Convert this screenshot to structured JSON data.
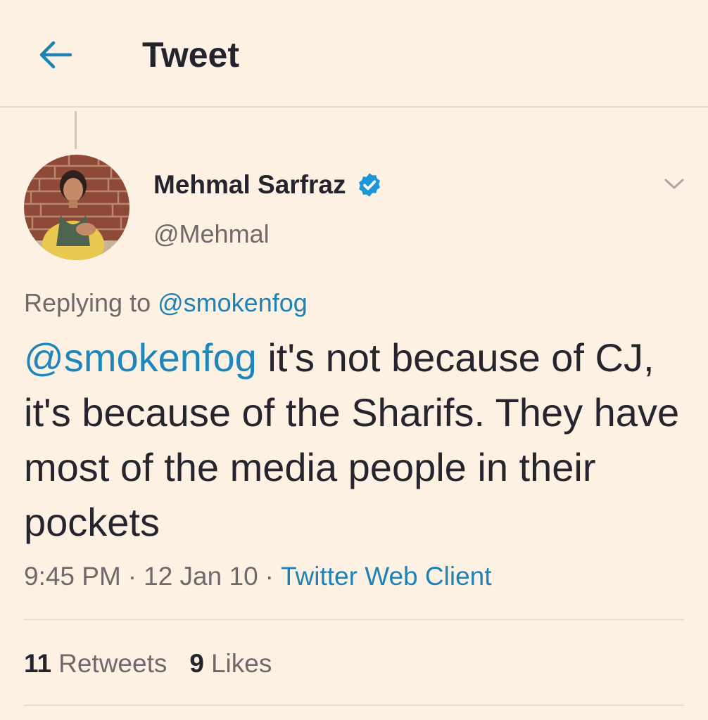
{
  "header": {
    "title": "Tweet",
    "back_icon": "arrow-left-icon",
    "accent": "#1f82b6"
  },
  "author": {
    "name": "Mehmal Sarfraz",
    "handle": "@Mehmal",
    "verified": true,
    "verified_icon": "verified-badge-icon",
    "verified_color": "#1e95d6"
  },
  "menu": {
    "icon": "chevron-down-icon"
  },
  "reply": {
    "prefix": "Replying to",
    "to": "@smokenfog"
  },
  "tweet": {
    "mention": "@smokenfog",
    "text": " it's not because of CJ, it's because of the Sharifs. They have most of the media people in their pockets"
  },
  "meta": {
    "time": "9:45 PM",
    "separator": "·",
    "date": "12 Jan 10",
    "source": "Twitter Web Client"
  },
  "stats": {
    "retweets_count": "11",
    "retweets_label": "Retweets",
    "likes_count": "9",
    "likes_label": "Likes"
  },
  "colors": {
    "background": "#fdf1e3",
    "text": "#26242c",
    "muted": "#6e6a6b",
    "link": "#1f82b6",
    "divider": "#ecdcc9"
  }
}
